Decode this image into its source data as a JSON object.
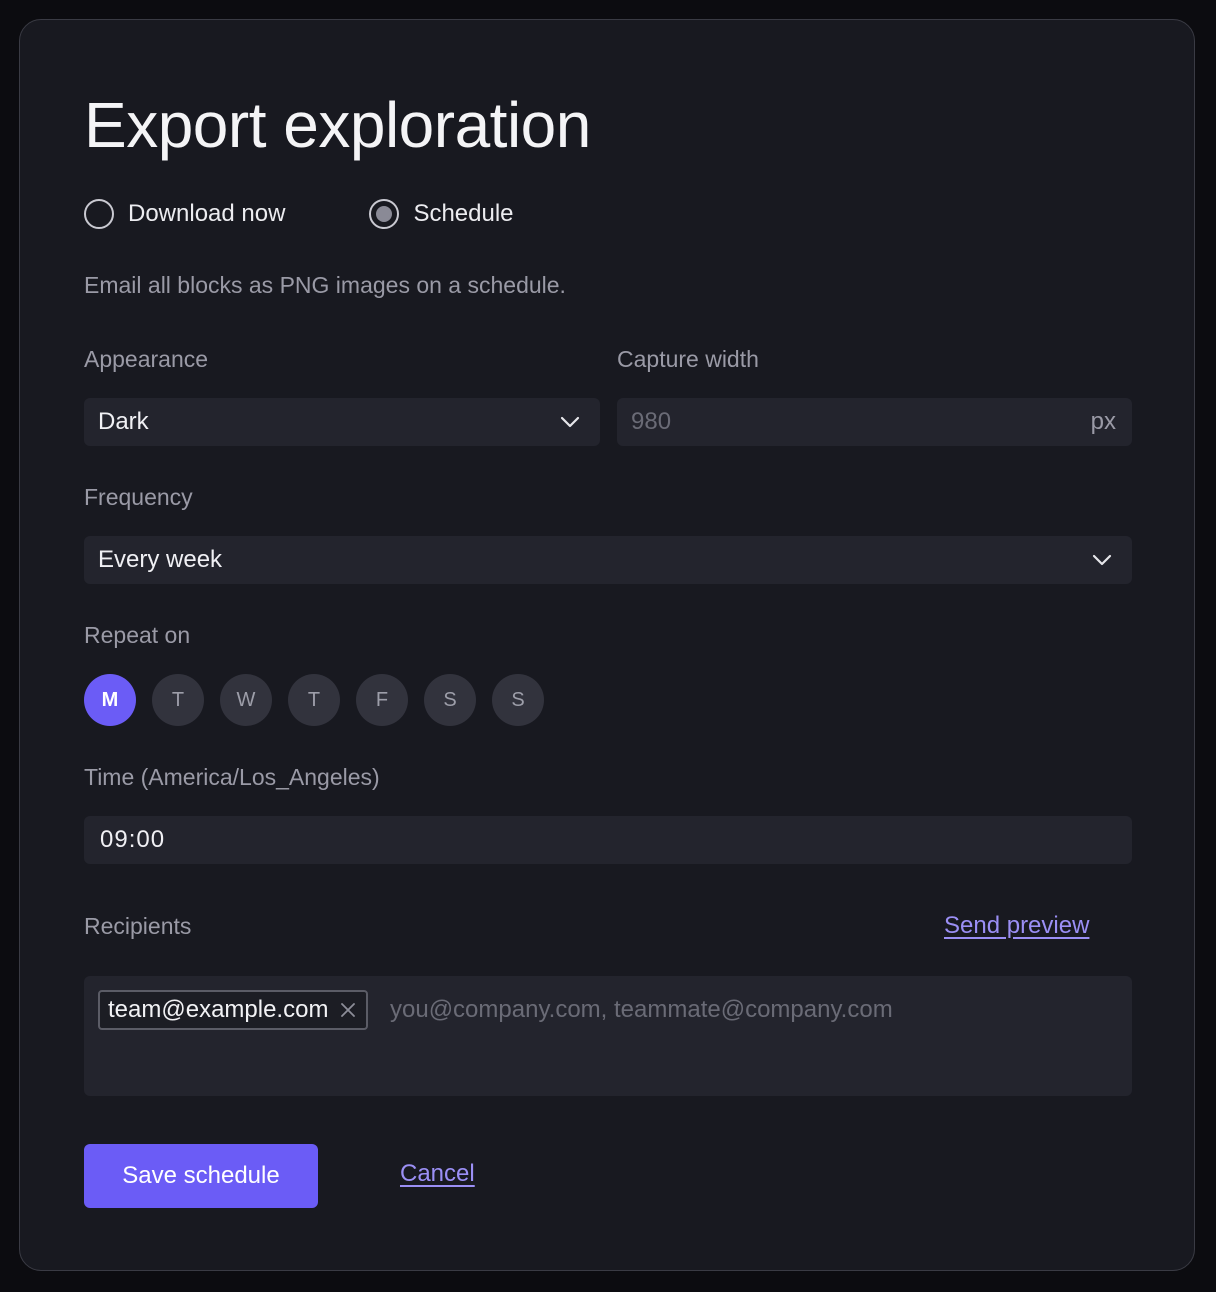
{
  "dialog": {
    "title": "Export exploration",
    "export_mode": {
      "options": [
        {
          "label": "Download now",
          "selected": false
        },
        {
          "label": "Schedule",
          "selected": true
        }
      ]
    },
    "description": "Email all blocks as PNG images on a schedule."
  },
  "appearance": {
    "label": "Appearance",
    "value": "Dark"
  },
  "capture_width": {
    "label": "Capture width",
    "placeholder": "980",
    "unit": "px"
  },
  "frequency": {
    "label": "Frequency",
    "value": "Every week"
  },
  "repeat_on": {
    "label": "Repeat on",
    "days": [
      {
        "letter": "M",
        "selected": true
      },
      {
        "letter": "T",
        "selected": false
      },
      {
        "letter": "W",
        "selected": false
      },
      {
        "letter": "T",
        "selected": false
      },
      {
        "letter": "F",
        "selected": false
      },
      {
        "letter": "S",
        "selected": false
      },
      {
        "letter": "S",
        "selected": false
      }
    ]
  },
  "time": {
    "label": "Time (America/Los_Angeles)",
    "value": "09:00"
  },
  "recipients": {
    "label": "Recipients",
    "send_preview_label": "Send preview",
    "chips": [
      "team@example.com"
    ],
    "placeholder": "you@company.com, teammate@company.com"
  },
  "actions": {
    "save_label": "Save schedule",
    "cancel_label": "Cancel"
  },
  "colors": {
    "accent": "#6b5cf6",
    "link": "#9b8ff5",
    "background": "#181920",
    "field": "#23242d"
  },
  "icons": {
    "select_chevron": "chevron-down-icon",
    "chip_remove": "close-icon"
  }
}
